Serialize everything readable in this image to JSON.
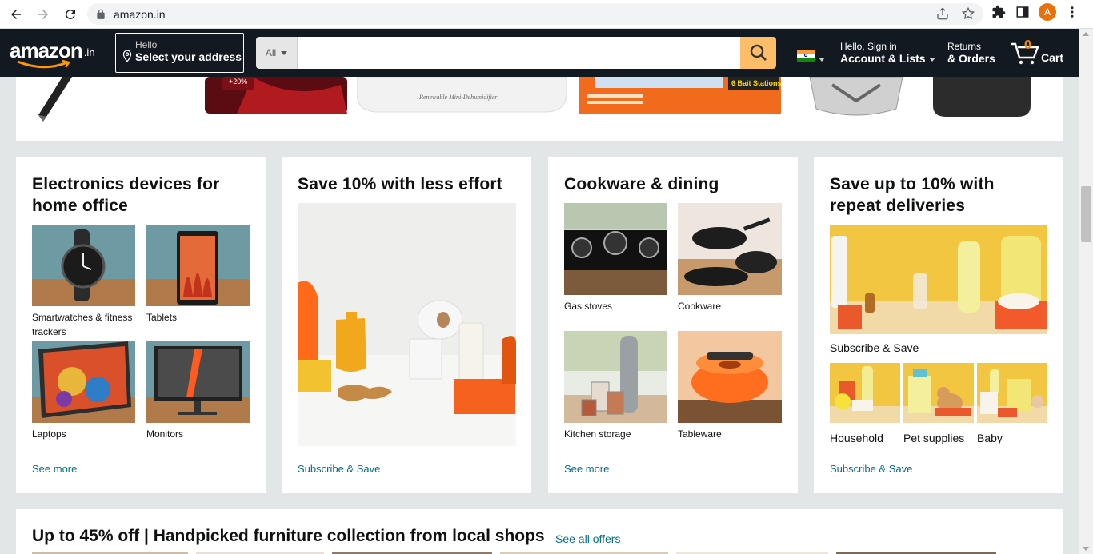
{
  "browser": {
    "url": "amazon.in",
    "profile_initial": "A"
  },
  "header": {
    "logo_text": "amazon",
    "logo_tld": ".in",
    "address_line1": "Hello",
    "address_line2": "Select your address",
    "search_category": "All",
    "search_placeholder": "",
    "account_line1": "Hello, Sign in",
    "account_line2": "Account & Lists",
    "orders_line1": "Returns",
    "orders_line2": "& Orders",
    "cart_count": "0",
    "cart_label": "Cart"
  },
  "strip": {
    "promo_badge": "+20%",
    "dehumidifier_caption": "Renewable Mini-Dehumidifier",
    "bait_label": "6 Bait Stations"
  },
  "cards": [
    {
      "title": "Electronics devices for home office",
      "tiles": [
        {
          "label": "Smartwatches & fitness trackers"
        },
        {
          "label": "Tablets"
        },
        {
          "label": "Laptops"
        },
        {
          "label": "Monitors"
        }
      ],
      "link": "See more"
    },
    {
      "title": "Save 10% with less effort",
      "link": "Subscribe & Save"
    },
    {
      "title": "Cookware & dining",
      "tiles": [
        {
          "label": "Gas stoves"
        },
        {
          "label": "Cookware"
        },
        {
          "label": "Kitchen storage"
        },
        {
          "label": "Tableware"
        }
      ],
      "link": "See more"
    },
    {
      "title": "Save up to 10% with repeat deliveries",
      "hero_label": "Subscribe & Save",
      "tiles": [
        {
          "label": "Household"
        },
        {
          "label": "Pet supplies"
        },
        {
          "label": "Baby"
        }
      ],
      "link": "Subscribe & Save"
    }
  ],
  "bottom": {
    "title": "Up to 45% off | Handpicked furniture collection from local shops",
    "link": "See all offers"
  },
  "colors": {
    "header_bg": "#131921",
    "search_button": "#febd69",
    "link": "#007185",
    "cart_count": "#f08804"
  }
}
